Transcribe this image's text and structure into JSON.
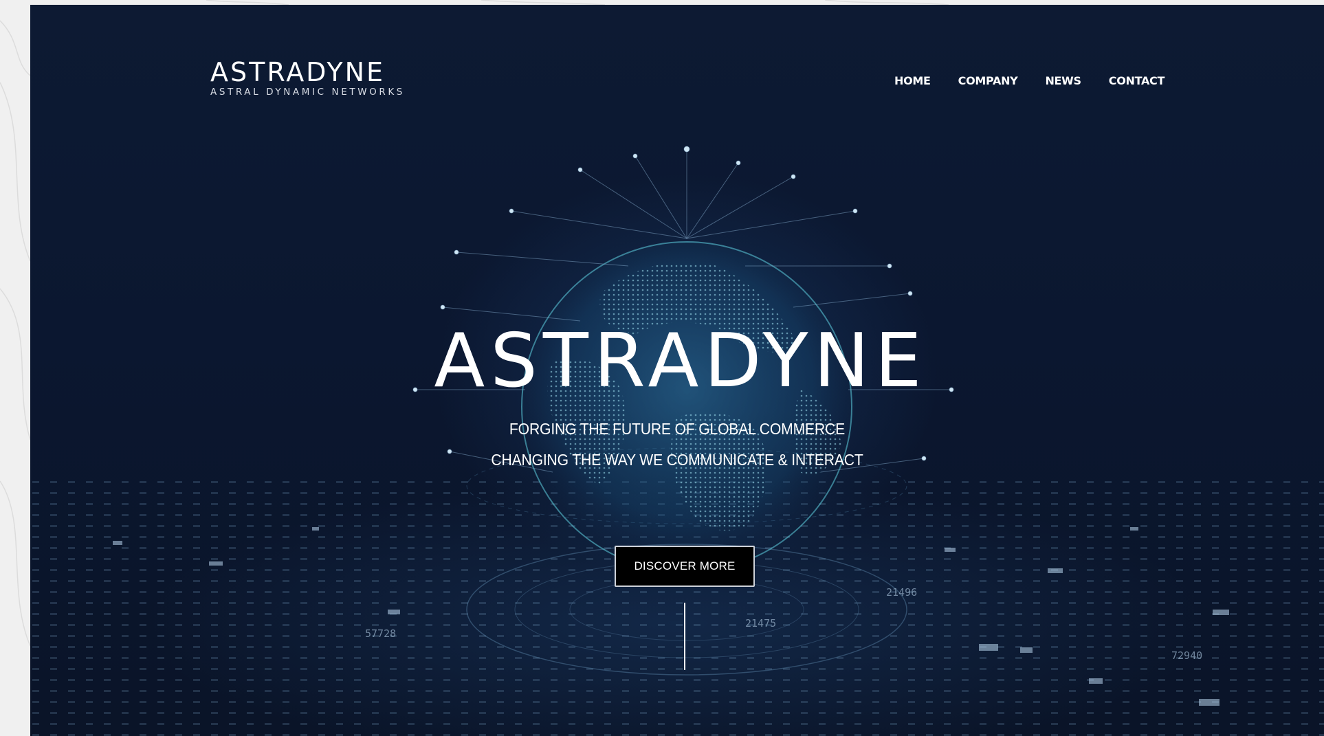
{
  "brand": {
    "name": "ASTRADYNE",
    "tagline": "ASTRAL DYNAMIC NETWORKS"
  },
  "nav": {
    "items": [
      {
        "label": "HOME"
      },
      {
        "label": "COMPANY"
      },
      {
        "label": "NEWS"
      },
      {
        "label": "CONTACT"
      }
    ]
  },
  "hero": {
    "title": "ASTRADYNE",
    "line1": "FORGING THE FUTURE OF GLOBAL COMMERCE",
    "line2": "CHANGING THE WAY WE COMMUNICATE & INTERACT",
    "cta_label": "DISCOVER MORE"
  },
  "background_labels": [
    "57728",
    "21475",
    "21496",
    "72940"
  ],
  "colors": {
    "hero_bg": "#0b1730",
    "text": "#ffffff",
    "cta_bg": "#000000",
    "globe_accent": "#5fd0e0"
  }
}
